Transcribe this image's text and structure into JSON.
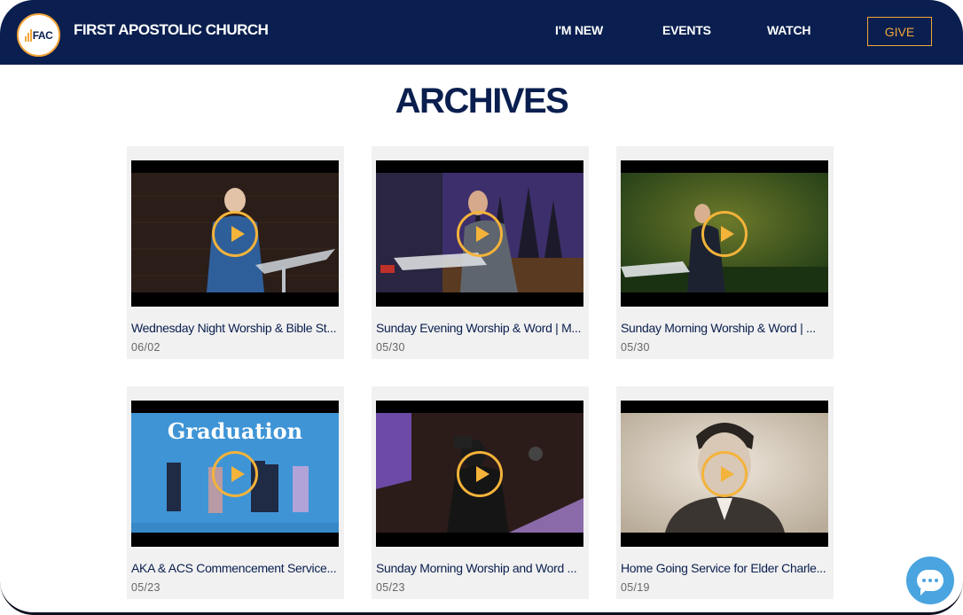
{
  "header": {
    "logo_text": "FAC",
    "site_title": "FIRST APOSTOLIC CHURCH",
    "nav": [
      {
        "label": "I'M NEW"
      },
      {
        "label": "EVENTS"
      },
      {
        "label": "WATCH"
      }
    ],
    "give_label": "GIVE"
  },
  "page_title": "ARCHIVES",
  "videos": [
    {
      "title": "Wednesday Night Worship & Bible St...",
      "date": "06/02",
      "icon": "play-icon"
    },
    {
      "title": "Sunday Evening Worship & Word | M...",
      "date": "05/30",
      "icon": "play-icon"
    },
    {
      "title": "Sunday Morning Worship & Word | ...",
      "date": "05/30",
      "icon": "play-icon"
    },
    {
      "title": "AKA & ACS Commencement Service...",
      "date": "05/23",
      "icon": "play-icon",
      "thumb_text": "Graduation"
    },
    {
      "title": "Sunday Morning Worship and Word ...",
      "date": "05/23",
      "icon": "play-icon"
    },
    {
      "title": "Home Going Service for Elder Charle...",
      "date": "05/19",
      "icon": "play-icon"
    }
  ],
  "colors": {
    "header_bg": "#0a1f4f",
    "accent": "#f4a63a",
    "card_bg": "#f1f1f1",
    "chat": "#4aa4e0"
  },
  "chat_icon": "chat-bubble-icon"
}
